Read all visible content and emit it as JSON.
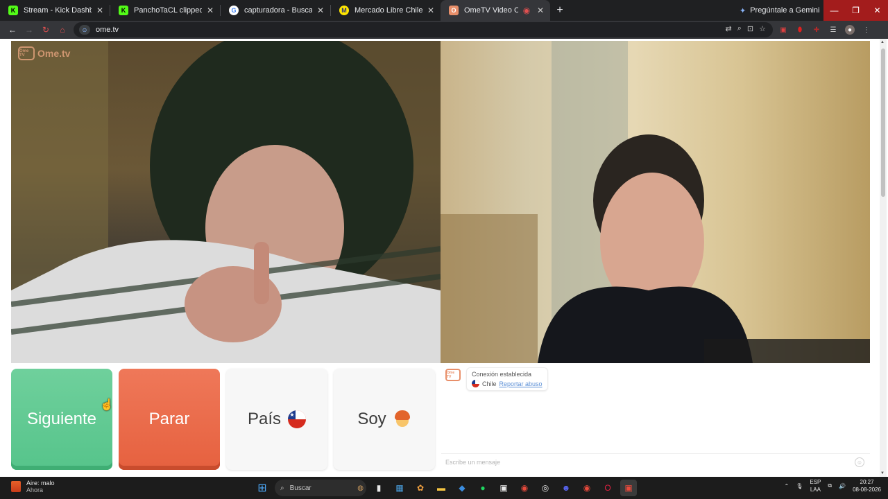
{
  "browser": {
    "tabs": [
      {
        "label": "Stream - Kick Dashboard",
        "icon": "kick-icon",
        "color": "#53fc18",
        "glyph": "K",
        "active": false
      },
      {
        "label": "PanchoTaCL clipped by cjskejrh",
        "icon": "kick-icon",
        "color": "#53fc18",
        "glyph": "K",
        "active": false
      },
      {
        "label": "capturadora - Buscar con Goog",
        "icon": "google-icon",
        "color": "#ffffff",
        "glyph": "G",
        "active": false
      },
      {
        "label": "Mercado Libre Chile - Donde c",
        "icon": "mercadolibre-icon",
        "color": "#ffe600",
        "glyph": "M",
        "active": false
      },
      {
        "label": "OmeTV Video Chat — Ome",
        "icon": "ometv-icon",
        "color": "#e88f6a",
        "glyph": "O",
        "active": true
      }
    ],
    "new_tab_label": "+",
    "gemini_label": "Pregúntale a Gemini",
    "url": "ome.tv"
  },
  "page": {
    "logo_text": "Ome.tv",
    "logo_badge": "Ome TV",
    "buttons": {
      "next": "Siguiente",
      "stop": "Parar",
      "country": "País",
      "gender": "Soy"
    },
    "chat": {
      "status": "Conexión establecida",
      "country": "Chile",
      "report": "Reportar abuso",
      "input_placeholder": "Escribe un mensaje"
    }
  },
  "taskbar": {
    "weather_title": "Aire: malo",
    "weather_sub": "Ahora",
    "search_label": "Buscar",
    "lang_top": "ESP",
    "lang_bottom": "LAA",
    "time": "20:27",
    "date": "08-08-2026"
  },
  "colors": {
    "next_button": "#56c48b",
    "stop_button": "#e6613f",
    "accent": "#e88f6a"
  }
}
